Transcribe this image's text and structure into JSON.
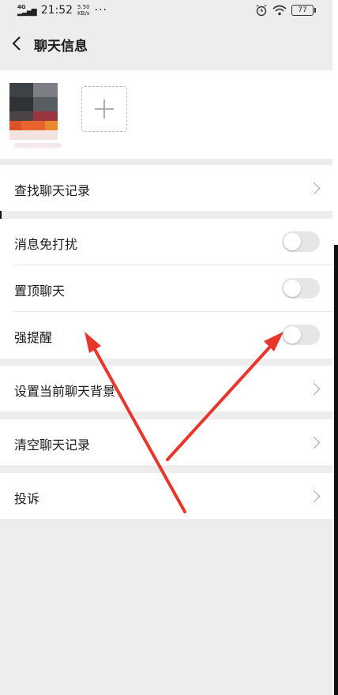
{
  "status_bar": {
    "network_top": "4G",
    "network_sub": "HD",
    "time": "21:52",
    "speed_value": "5.50",
    "speed_unit": "KB/s",
    "more": "···",
    "battery": "77"
  },
  "header": {
    "title": "聊天信息"
  },
  "sections": {
    "search_history": "查找聊天记录",
    "mute": "消息免打扰",
    "pin": "置顶聊天",
    "strong_remind": "强提醒",
    "set_background": "设置当前聊天背景",
    "clear_history": "清空聊天记录",
    "report": "投诉"
  },
  "toggles": {
    "mute_on": false,
    "pin_on": false,
    "strong_remind_on": false
  },
  "colors": {
    "annotation_arrow": "#e8362b",
    "toggle_off": "#e6e6e6",
    "background": "#ededed"
  }
}
